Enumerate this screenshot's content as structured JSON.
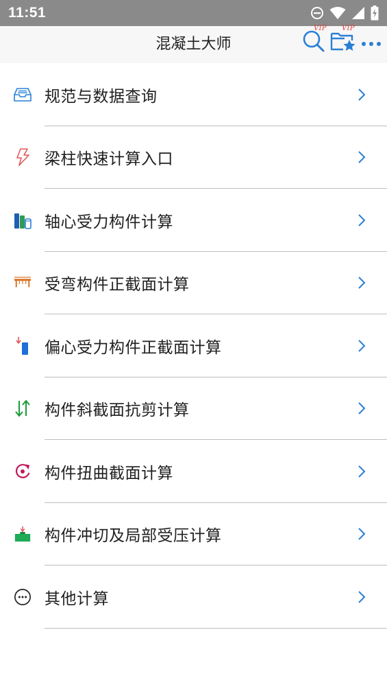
{
  "status_bar": {
    "time": "11:51",
    "icons": [
      "do-not-disturb-icon",
      "wifi-icon",
      "cellular-signal-icon",
      "battery-charging-icon"
    ]
  },
  "app_bar": {
    "title": "混凝土大师",
    "search_vip_badge": "VIP",
    "favorites_vip_badge": "VIP",
    "icons": [
      "search-icon",
      "favorites-folder-icon",
      "more-icon"
    ],
    "accent_color": "#2a7fd6"
  },
  "menu": {
    "items": [
      {
        "label": "规范与数据查询",
        "icon": "inbox-tray-icon",
        "icon_color": "#2a7fd6"
      },
      {
        "label": "梁柱快速计算入口",
        "icon": "lightning-icon",
        "icon_color": "#e05a5a"
      },
      {
        "label": "轴心受力构件计算",
        "icon": "column-members-icon",
        "icon_color": "#2a7fd6"
      },
      {
        "label": "受弯构件正截面计算",
        "icon": "bending-beam-icon",
        "icon_color": "#d86b1a"
      },
      {
        "label": "偏心受力构件正截面计算",
        "icon": "eccentric-load-icon",
        "icon_color": "#1e6fd9"
      },
      {
        "label": "构件斜截面抗剪计算",
        "icon": "shear-arrows-icon",
        "icon_color": "#1a9a3a"
      },
      {
        "label": "构件扭曲截面计算",
        "icon": "torsion-rotate-icon",
        "icon_color": "#c2185b"
      },
      {
        "label": "构件冲切及局部受压计算",
        "icon": "punching-block-icon",
        "icon_color": "#1faa55"
      },
      {
        "label": "其他计算",
        "icon": "more-circle-icon",
        "icon_color": "#222222"
      }
    ],
    "chevron_icon": "chevron-right-icon",
    "chevron_color": "#2a7fd6"
  }
}
